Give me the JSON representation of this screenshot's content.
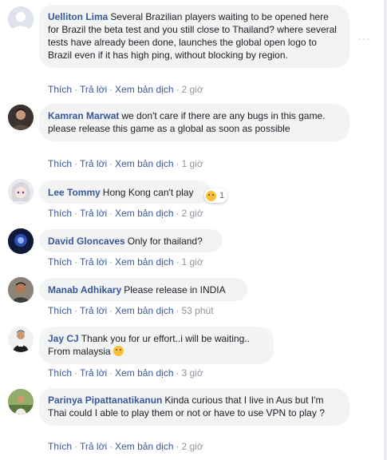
{
  "actions": {
    "like": "Thích",
    "reply": "Trả lời",
    "translate": "Xem bản dịch",
    "sep": "·"
  },
  "more_options": "···",
  "comments": [
    {
      "author": "Uelliton Lima",
      "text": "Several Brazilian players waiting to be opened here for Brazil the beta test and you still close to Thailand? where several tests have already been done, launches the global open logo to Brazil even if it has high ping, without blocking by region.",
      "time": "2 giờ",
      "avatar": "avatar-placeholder",
      "has_more": true
    },
    {
      "author": "Kamran Marwat",
      "text": "we don't care if there are any bugs in this game. please release this game as a global as soon as possible",
      "time": "1 giờ",
      "avatar": "avatar-photo"
    },
    {
      "author": "Lee Tommy",
      "text": "Hong Kong can't play",
      "time": "2 giờ",
      "avatar": "avatar-anime",
      "reaction": {
        "emoji": "sad-face-icon",
        "count": "1"
      }
    },
    {
      "author": "David Gloncaves",
      "text": "Only for thailand?",
      "time": "1 giờ",
      "avatar": "avatar-dark"
    },
    {
      "author": "Manab Adhikary",
      "text": "Please release in INDIA",
      "time": "53 phút",
      "avatar": "avatar-photo"
    },
    {
      "author": "Jay CJ",
      "text": "Thank you for ur effort..i will be waiting.. From malaysia",
      "time": "3 giờ",
      "avatar": "avatar-shirt",
      "emoji": "smile-icon"
    },
    {
      "author": "Parinya Pipattanatikanun",
      "text": "Kinda curious that I live in Aus but I'm Thai could I able to play them or not or have to use VPN to play ?",
      "time": "2 giờ",
      "avatar": "avatar-outdoor"
    }
  ]
}
